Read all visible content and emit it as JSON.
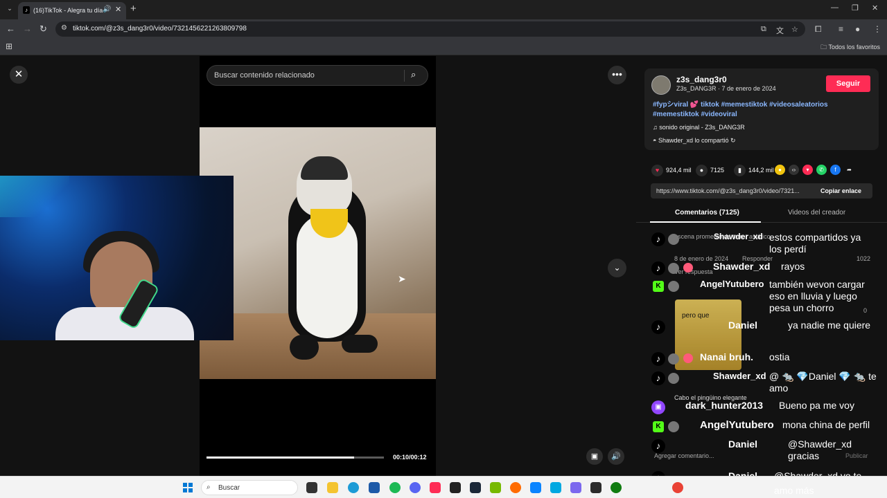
{
  "browser": {
    "tab_title": "(16)TikTok - Alegra tu día",
    "url": "tiktok.com/@z3s_dang3r0/video/7321456221263809798",
    "bookmarks_all": "Todos los favoritos"
  },
  "viewer": {
    "search_placeholder": "Buscar contenido relacionado",
    "time": "00:10/00:12",
    "progress_fraction": 0.8333
  },
  "post": {
    "username": "z3s_dang3r0",
    "subline": "Z3s_DANG3R · 7 de enero de 2024",
    "follow_label": "Seguir",
    "tags_line1": "#fypシviral 💕 tiktok #memestiktok #videosaleatorios",
    "tags_line2": "#memestiktok #videoviral",
    "sound": "♫  sonido original - Z3s_DANG3R",
    "shared": "Shawder_xd lo compartió",
    "likes": "924,4 mil",
    "comments_count": "7125",
    "saves": "144,2 mil",
    "link": "https://www.tiktok.com/@z3s_dang3r0/video/7321...",
    "copy_label": "Copiar enlace",
    "tab_comments": "Comentarios (7125)",
    "tab_creator": "Videos del creador"
  },
  "comments_overlay": [
    {
      "platform": "tiktok",
      "user": "Shawder_xd",
      "msg": "estos compartidos ya"
    },
    {
      "platform": "none",
      "user": "",
      "msg": "los perdí"
    },
    {
      "platform": "tiktok",
      "user": "Shawder_xd",
      "msg": "rayos"
    },
    {
      "platform": "kick",
      "user": "AngelYutubero",
      "msg": "también wevon cargar"
    },
    {
      "platform": "none",
      "user": "",
      "msg": "eso en lluvia y luego"
    },
    {
      "platform": "none",
      "user": "",
      "msg": "pesa un chorro"
    },
    {
      "platform": "tiktok",
      "user": "Daniel",
      "msg": "ya nadie me quiere"
    },
    {
      "platform": "tiktok",
      "user": "Nanai bruh.",
      "msg": "ostia"
    },
    {
      "platform": "tiktok",
      "user": "Shawder_xd",
      "msg": "@ 🐀 💎Daniel 💎 🐀 te"
    },
    {
      "platform": "none",
      "user": "",
      "msg": "amo"
    },
    {
      "platform": "twitch",
      "user": "dark_hunter2013",
      "msg": "Bueno pa me voy"
    },
    {
      "platform": "kick",
      "user": "AngelYutubero",
      "msg": "mona china de perfil"
    },
    {
      "platform": "tiktok",
      "user": "Daniel",
      "msg": "@Shawder_xd"
    },
    {
      "platform": "none",
      "user": "",
      "msg": "gracias"
    },
    {
      "platform": "tiktok",
      "user": "Daniel",
      "msg": "@Shawder_xd yo te"
    },
    {
      "platform": "none",
      "user": "",
      "msg": "amo más"
    }
  ],
  "comment_bg": {
    "c1_sub": "escena promedio de terror asiático",
    "c1_date": "8 de enero de 2024",
    "c1_reply": "Responder",
    "c1_likes": "1022",
    "replies": "Ver respuesta",
    "c3_likes": "0",
    "meme_text": "pero que",
    "cabo": "Cabo el pingüino elegante",
    "add_comment": "Agregar comentario...",
    "publish": "Publicar"
  },
  "taskbar": {
    "search": "Buscar"
  },
  "colors": {
    "accent": "#fe2c55",
    "tags": "#8bb8ff"
  }
}
